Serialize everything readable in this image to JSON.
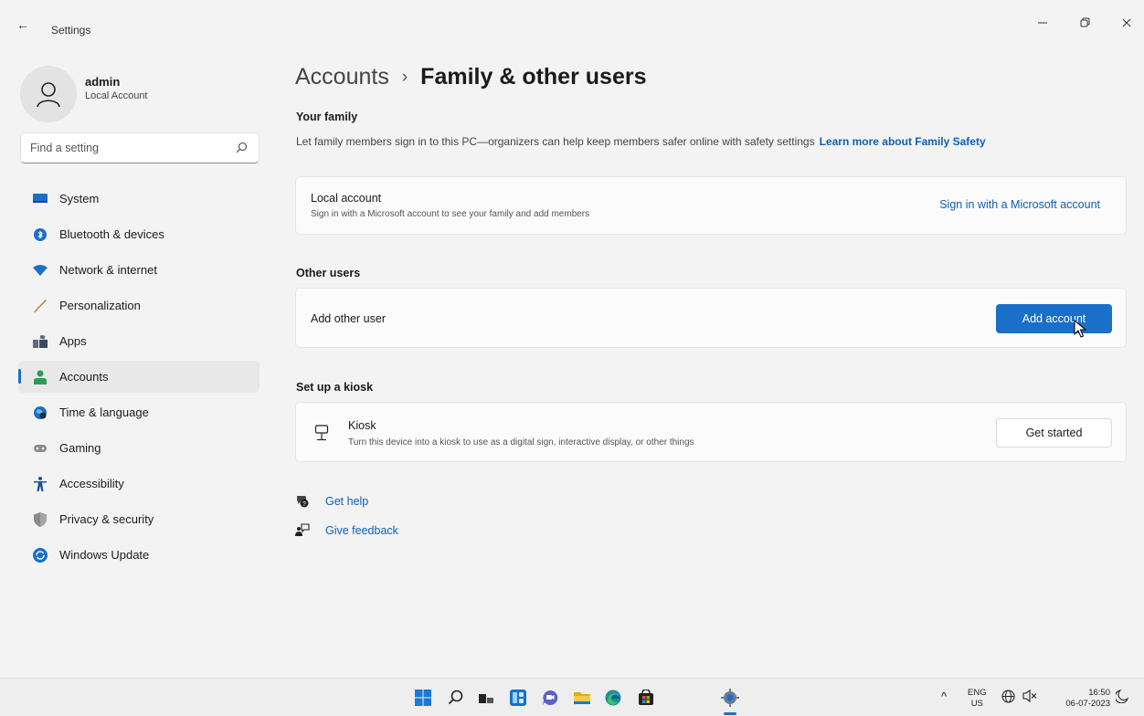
{
  "window": {
    "title": "Settings",
    "back_icon": "back-arrow-icon",
    "controls": [
      "minimize",
      "maximize",
      "close"
    ]
  },
  "profile": {
    "name": "admin",
    "type": "Local Account"
  },
  "search": {
    "placeholder": "Find a setting"
  },
  "sidebar": {
    "items": [
      {
        "label": "System",
        "icon": "system-icon",
        "color": "#1a6fc9"
      },
      {
        "label": "Bluetooth & devices",
        "icon": "bluetooth-icon",
        "color": "#1a6fc9"
      },
      {
        "label": "Network & internet",
        "icon": "wifi-icon",
        "color": "#1a6fc9"
      },
      {
        "label": "Personalization",
        "icon": "brush-icon",
        "color": "#d97b2a"
      },
      {
        "label": "Apps",
        "icon": "apps-icon",
        "color": "#5a6b82"
      },
      {
        "label": "Accounts",
        "icon": "accounts-icon",
        "color": "#2a9d55",
        "active": true
      },
      {
        "label": "Time & language",
        "icon": "globe-clock-icon",
        "color": "#1a6fc9"
      },
      {
        "label": "Gaming",
        "icon": "gamepad-icon",
        "color": "#8a8a8a"
      },
      {
        "label": "Accessibility",
        "icon": "accessibility-icon",
        "color": "#1a4fa0"
      },
      {
        "label": "Privacy & security",
        "icon": "shield-icon",
        "color": "#8a8a8a"
      },
      {
        "label": "Windows Update",
        "icon": "update-icon",
        "color": "#1a6fc9"
      }
    ]
  },
  "breadcrumb": {
    "parent": "Accounts",
    "separator": "›",
    "current": "Family & other users"
  },
  "family": {
    "section_title": "Your family",
    "description": "Let family members sign in to this PC—organizers can help keep members safer online with safety settings",
    "learn_more": "Learn more about Family Safety",
    "card_title": "Local account",
    "card_subtitle": "Sign in with a Microsoft account to see your family and add members",
    "card_action": "Sign in with a Microsoft account"
  },
  "other_users": {
    "section_title": "Other users",
    "card_title": "Add other user",
    "button": "Add account"
  },
  "kiosk": {
    "section_title": "Set up a kiosk",
    "card_title": "Kiosk",
    "card_subtitle": "Turn this device into a kiosk to use as a digital sign, interactive display, or other things",
    "button": "Get started",
    "icon": "kiosk-icon"
  },
  "help": {
    "get_help": "Get help",
    "give_feedback": "Give feedback"
  },
  "taskbar": {
    "apps": [
      "start",
      "search",
      "task-view",
      "widgets",
      "chat",
      "file-explorer",
      "edge",
      "store",
      "settings"
    ],
    "language_top": "ENG",
    "language_bottom": "US",
    "time": "16:50",
    "date": "06-07-2023"
  },
  "colors": {
    "accent": "#1a6fc9",
    "link": "#0f5fb5",
    "background": "#f3f3f3",
    "card": "#fbfbfb"
  }
}
